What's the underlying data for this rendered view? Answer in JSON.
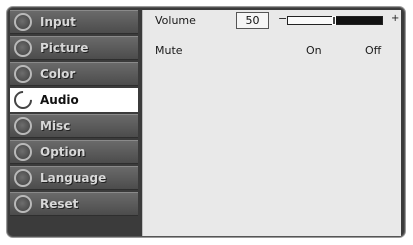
{
  "menu": {
    "items": [
      {
        "label": "Input"
      },
      {
        "label": "Picture"
      },
      {
        "label": "Color"
      },
      {
        "label": "Audio"
      },
      {
        "label": "Misc"
      },
      {
        "label": "Option"
      },
      {
        "label": "Language"
      },
      {
        "label": "Reset"
      }
    ],
    "active_item": "Audio"
  },
  "audio": {
    "volume_label": "Volume",
    "volume_value": "50",
    "volume_level": 0.5,
    "decrease_symbol": "−",
    "increase_symbol": "+",
    "mute_label": "Mute",
    "mute_on_label": "On",
    "mute_off_label": "Off"
  },
  "icons": {
    "menu_item": "ring-icon",
    "active_menu_item": "open-ring-icon"
  },
  "colors": {
    "sidebar_item": "#5b5b5b",
    "active_item": "#ffffff",
    "panel": "#e9e9e9",
    "frame": "#3b3b3b"
  }
}
